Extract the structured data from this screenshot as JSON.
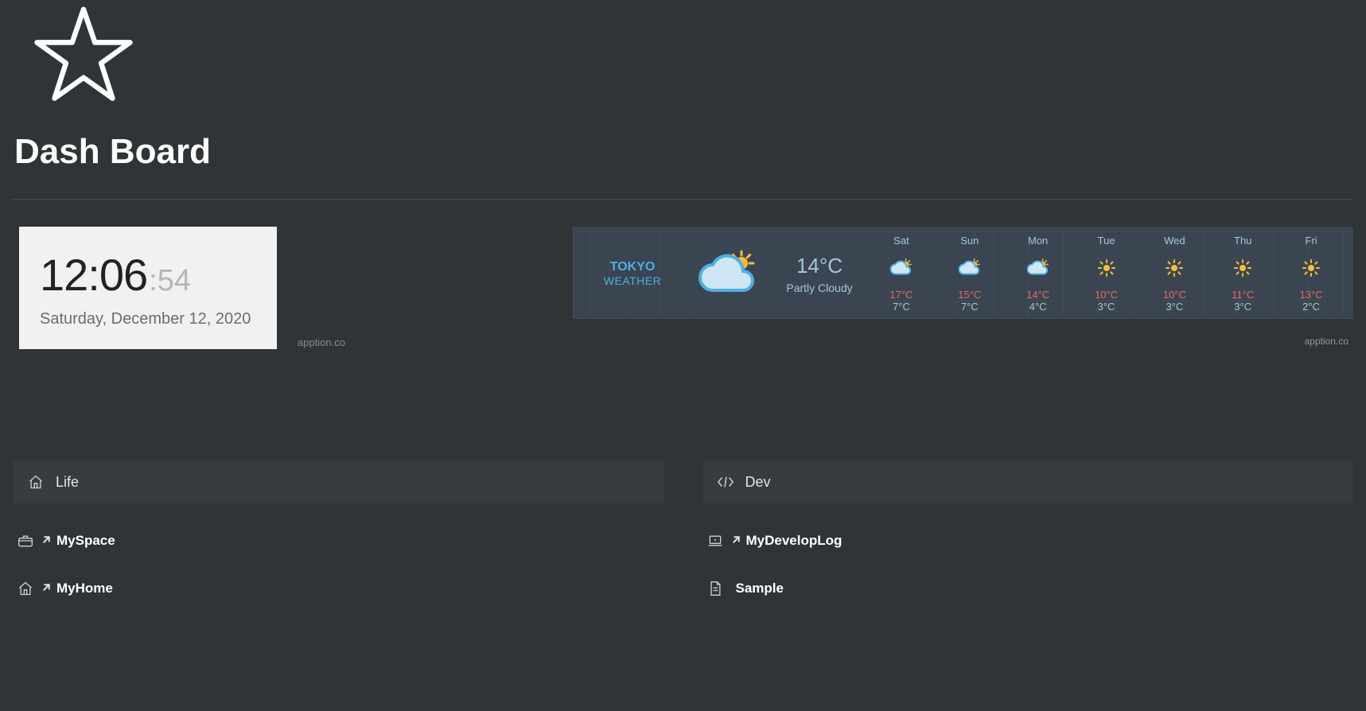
{
  "header": {
    "title": "Dash Board"
  },
  "clock": {
    "hhmm": "12:06",
    "ss": ":54",
    "date": "Saturday, December 12, 2020",
    "attribution": "apption.co"
  },
  "weather": {
    "location_line1": "TOKYO",
    "location_line2": "WEATHER",
    "current_temp": "14°C",
    "current_desc": "Partly Cloudy",
    "attribution": "apption.co",
    "days": [
      {
        "name": "Sat",
        "icon": "partly-cloudy",
        "hi": "17°C",
        "lo": "7°C"
      },
      {
        "name": "Sun",
        "icon": "partly-cloudy",
        "hi": "15°C",
        "lo": "7°C"
      },
      {
        "name": "Mon",
        "icon": "partly-cloudy",
        "hi": "14°C",
        "lo": "4°C"
      },
      {
        "name": "Tue",
        "icon": "sunny",
        "hi": "10°C",
        "lo": "3°C"
      },
      {
        "name": "Wed",
        "icon": "sunny",
        "hi": "10°C",
        "lo": "3°C"
      },
      {
        "name": "Thu",
        "icon": "sunny",
        "hi": "11°C",
        "lo": "3°C"
      },
      {
        "name": "Fri",
        "icon": "sunny",
        "hi": "13°C",
        "lo": "2°C"
      }
    ]
  },
  "columns": {
    "life": {
      "title": "Life",
      "items": [
        {
          "icon": "workspace-icon",
          "external": true,
          "label": "MySpace"
        },
        {
          "icon": "home-icon",
          "external": true,
          "label": "MyHome"
        }
      ]
    },
    "dev": {
      "title": "Dev",
      "items": [
        {
          "icon": "laptop-icon",
          "external": true,
          "label": "MyDevelopLog"
        },
        {
          "icon": "page-icon",
          "external": false,
          "label": "Sample"
        }
      ]
    }
  }
}
